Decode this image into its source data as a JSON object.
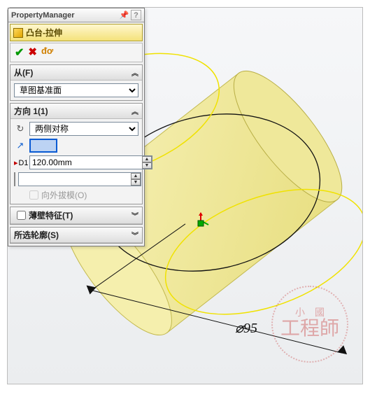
{
  "propertyManager": {
    "header": "PropertyManager",
    "featureTitle": "凸台-拉伸",
    "sections": {
      "from": {
        "label": "从(F)",
        "value": "草图基准面"
      },
      "direction1": {
        "label": "方向 1(1)",
        "endCondition": "两侧对称",
        "depth": "120.00mm",
        "draftOutward": "向外拔模(O)"
      },
      "thinFeature": {
        "label": "薄壁特征(T)"
      },
      "selectedContours": {
        "label": "所选轮廓(S)"
      }
    }
  },
  "canvas": {
    "dimension": "⌀95"
  },
  "watermark": {
    "line1": "小國",
    "line2": "工程師"
  }
}
